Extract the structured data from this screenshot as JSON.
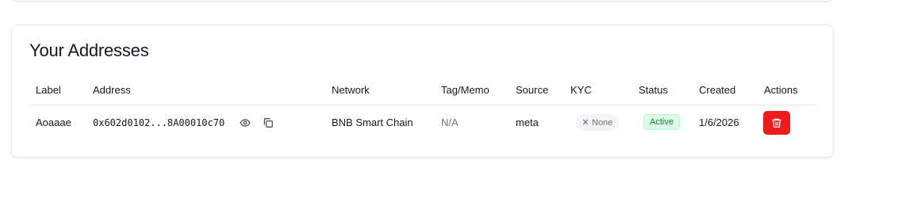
{
  "card": {
    "title": "Your Addresses"
  },
  "table": {
    "columns": [
      "Label",
      "Address",
      "Network",
      "Tag/Memo",
      "Source",
      "KYC",
      "Status",
      "Created",
      "Actions"
    ],
    "rows": [
      {
        "label": "Aoaaae",
        "address": "0x602d0102...8A00010c70",
        "network": "BNB Smart Chain",
        "tag_memo": "N/A",
        "source": "meta",
        "kyc": "None",
        "status": "Active",
        "created": "1/6/2026"
      }
    ]
  },
  "icons": {
    "reveal": "eye-icon",
    "copy": "copy-icon",
    "kyc_none": "x-icon",
    "delete": "trash-icon"
  },
  "colors": {
    "delete_button": "#ef1b1b",
    "status_active_bg": "#dcfce7",
    "status_active_text": "#15803d",
    "kyc_badge_bg": "#f3f4f6"
  }
}
